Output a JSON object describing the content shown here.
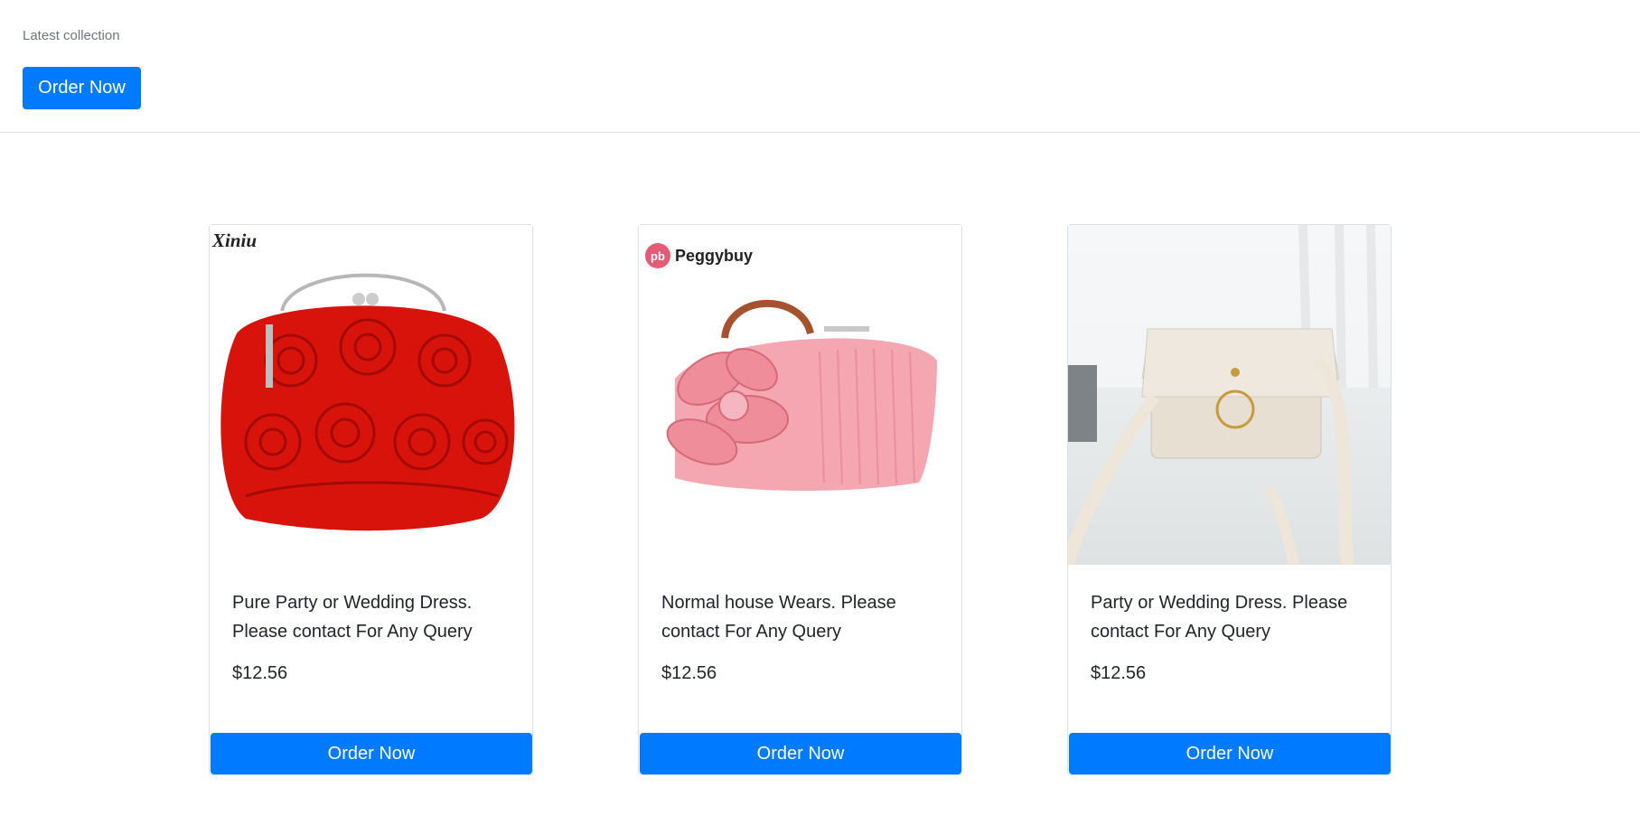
{
  "header": {
    "caption": "Latest collection",
    "order_label": "Order Now"
  },
  "products": [
    {
      "image_icon": "red-rose-clutch-bag-image",
      "brand": "Xiniu",
      "description": "Pure Party or Wedding Dress. Please contact For Any Query",
      "price": "$12.56",
      "order_label": "Order Now"
    },
    {
      "image_icon": "pink-flower-clutch-bag-image",
      "brand": "Peggybuy",
      "brand_badge": "pb",
      "description": "Normal house Wears. Please contact For Any Query",
      "price": "$12.56",
      "order_label": "Order Now"
    },
    {
      "image_icon": "cream-crossbody-bag-image",
      "description": "Party or Wedding Dress. Please contact For Any Query",
      "price": "$12.56",
      "order_label": "Order Now"
    }
  ],
  "colors": {
    "primary": "#007bff",
    "border": "#dee2e6",
    "muted_text": "#6c757d"
  }
}
